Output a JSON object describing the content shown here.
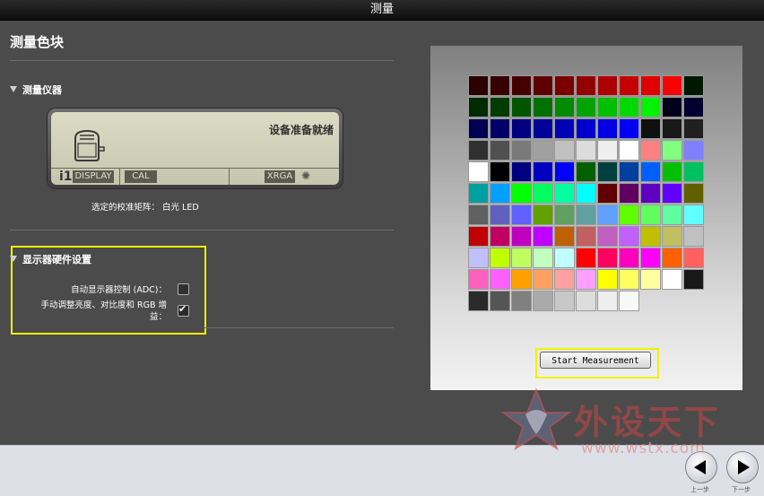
{
  "window": {
    "title": "测量"
  },
  "page": {
    "title": "测量色块"
  },
  "instrument": {
    "section_title": "测量仪器",
    "status": "设备准备就绪",
    "brand": "i1",
    "display_label": "DISPLAY",
    "cal_label": "CAL",
    "mode_label": "XRGA",
    "matrix_label": "选定的校准矩阵： 白光 LED"
  },
  "hardware": {
    "section_title": "显示器硬件设置",
    "adc_label": "自动显示器控制 (ADC)：",
    "adc_checked": false,
    "manual_label_line1": "手动调整亮度、对比度和 RGB 增",
    "manual_label_line2": "益：",
    "manual_checked": true
  },
  "preview": {
    "start_button": "Start Measurement",
    "patch_colors": [
      [
        "#2a0000",
        "#360000",
        "#450000",
        "#5e0000",
        "#7a0000",
        "#940000",
        "#ad0000",
        "#c60000",
        "#e00000",
        "#fa0000",
        "#001800"
      ],
      [
        "#002a00",
        "#003c00",
        "#005600",
        "#007000",
        "#008a00",
        "#00a400",
        "#00be00",
        "#00d800",
        "#00f200",
        "#00001a",
        "#000030"
      ],
      [
        "#000050",
        "#000068",
        "#000080",
        "#00009a",
        "#0000b4",
        "#0000cc",
        "#0000e4",
        "#0000fc",
        "#101010",
        "#181818",
        "#202020"
      ],
      [
        "#303030",
        "#505050",
        "#7a7a7a",
        "#a0a0a0",
        "#c0c0c0",
        "#dcdcdc",
        "#eeeeee",
        "#ffffff",
        "#ff8080",
        "#80ff80",
        "#8080ff"
      ],
      [
        "#ffffff",
        "#000000",
        "#000080",
        "#0000c0",
        "#0000ff",
        "#006000",
        "#004040",
        "#0040a0",
        "#0060ff",
        "#00c000",
        "#00c060"
      ],
      [
        "#00a0a0",
        "#00a0ff",
        "#00ff00",
        "#00ff60",
        "#00ffa0",
        "#00ffff",
        "#600000",
        "#600060",
        "#6000c0",
        "#6000ff",
        "#606000"
      ],
      [
        "#606060",
        "#6060c0",
        "#6060ff",
        "#60a000",
        "#60a060",
        "#60a0a0",
        "#60a0ff",
        "#60ff00",
        "#60ff60",
        "#60ffa0",
        "#60ffff"
      ],
      [
        "#c00000",
        "#c00060",
        "#c000c0",
        "#c000ff",
        "#c06000",
        "#c06060",
        "#c060c0",
        "#c060ff",
        "#c0c000",
        "#c0c060",
        "#c0c0c0"
      ],
      [
        "#c0c0ff",
        "#c0ff00",
        "#c0ff60",
        "#c0ffc0",
        "#c0ffff",
        "#ff0000",
        "#ff0060",
        "#ff00c0",
        "#ff00ff",
        "#ff6000",
        "#ff6060"
      ],
      [
        "#ff60c0",
        "#ff60ff",
        "#ffa000",
        "#ffa060",
        "#ffa0a0",
        "#ffa0ff",
        "#ffff00",
        "#ffff60",
        "#ffffa0",
        "#ffffff",
        "#181818"
      ],
      [
        "#2a2a2a",
        "#555555",
        "#808080",
        "#aaaaaa",
        "#c8c8c8",
        "#dddddd",
        "#eeeeee",
        "#f8f8f8"
      ]
    ]
  },
  "watermark": {
    "text": "外设天下",
    "url": "www.wstx.com"
  },
  "footer": {
    "prev_label": "上一步",
    "next_label": "下一步"
  }
}
